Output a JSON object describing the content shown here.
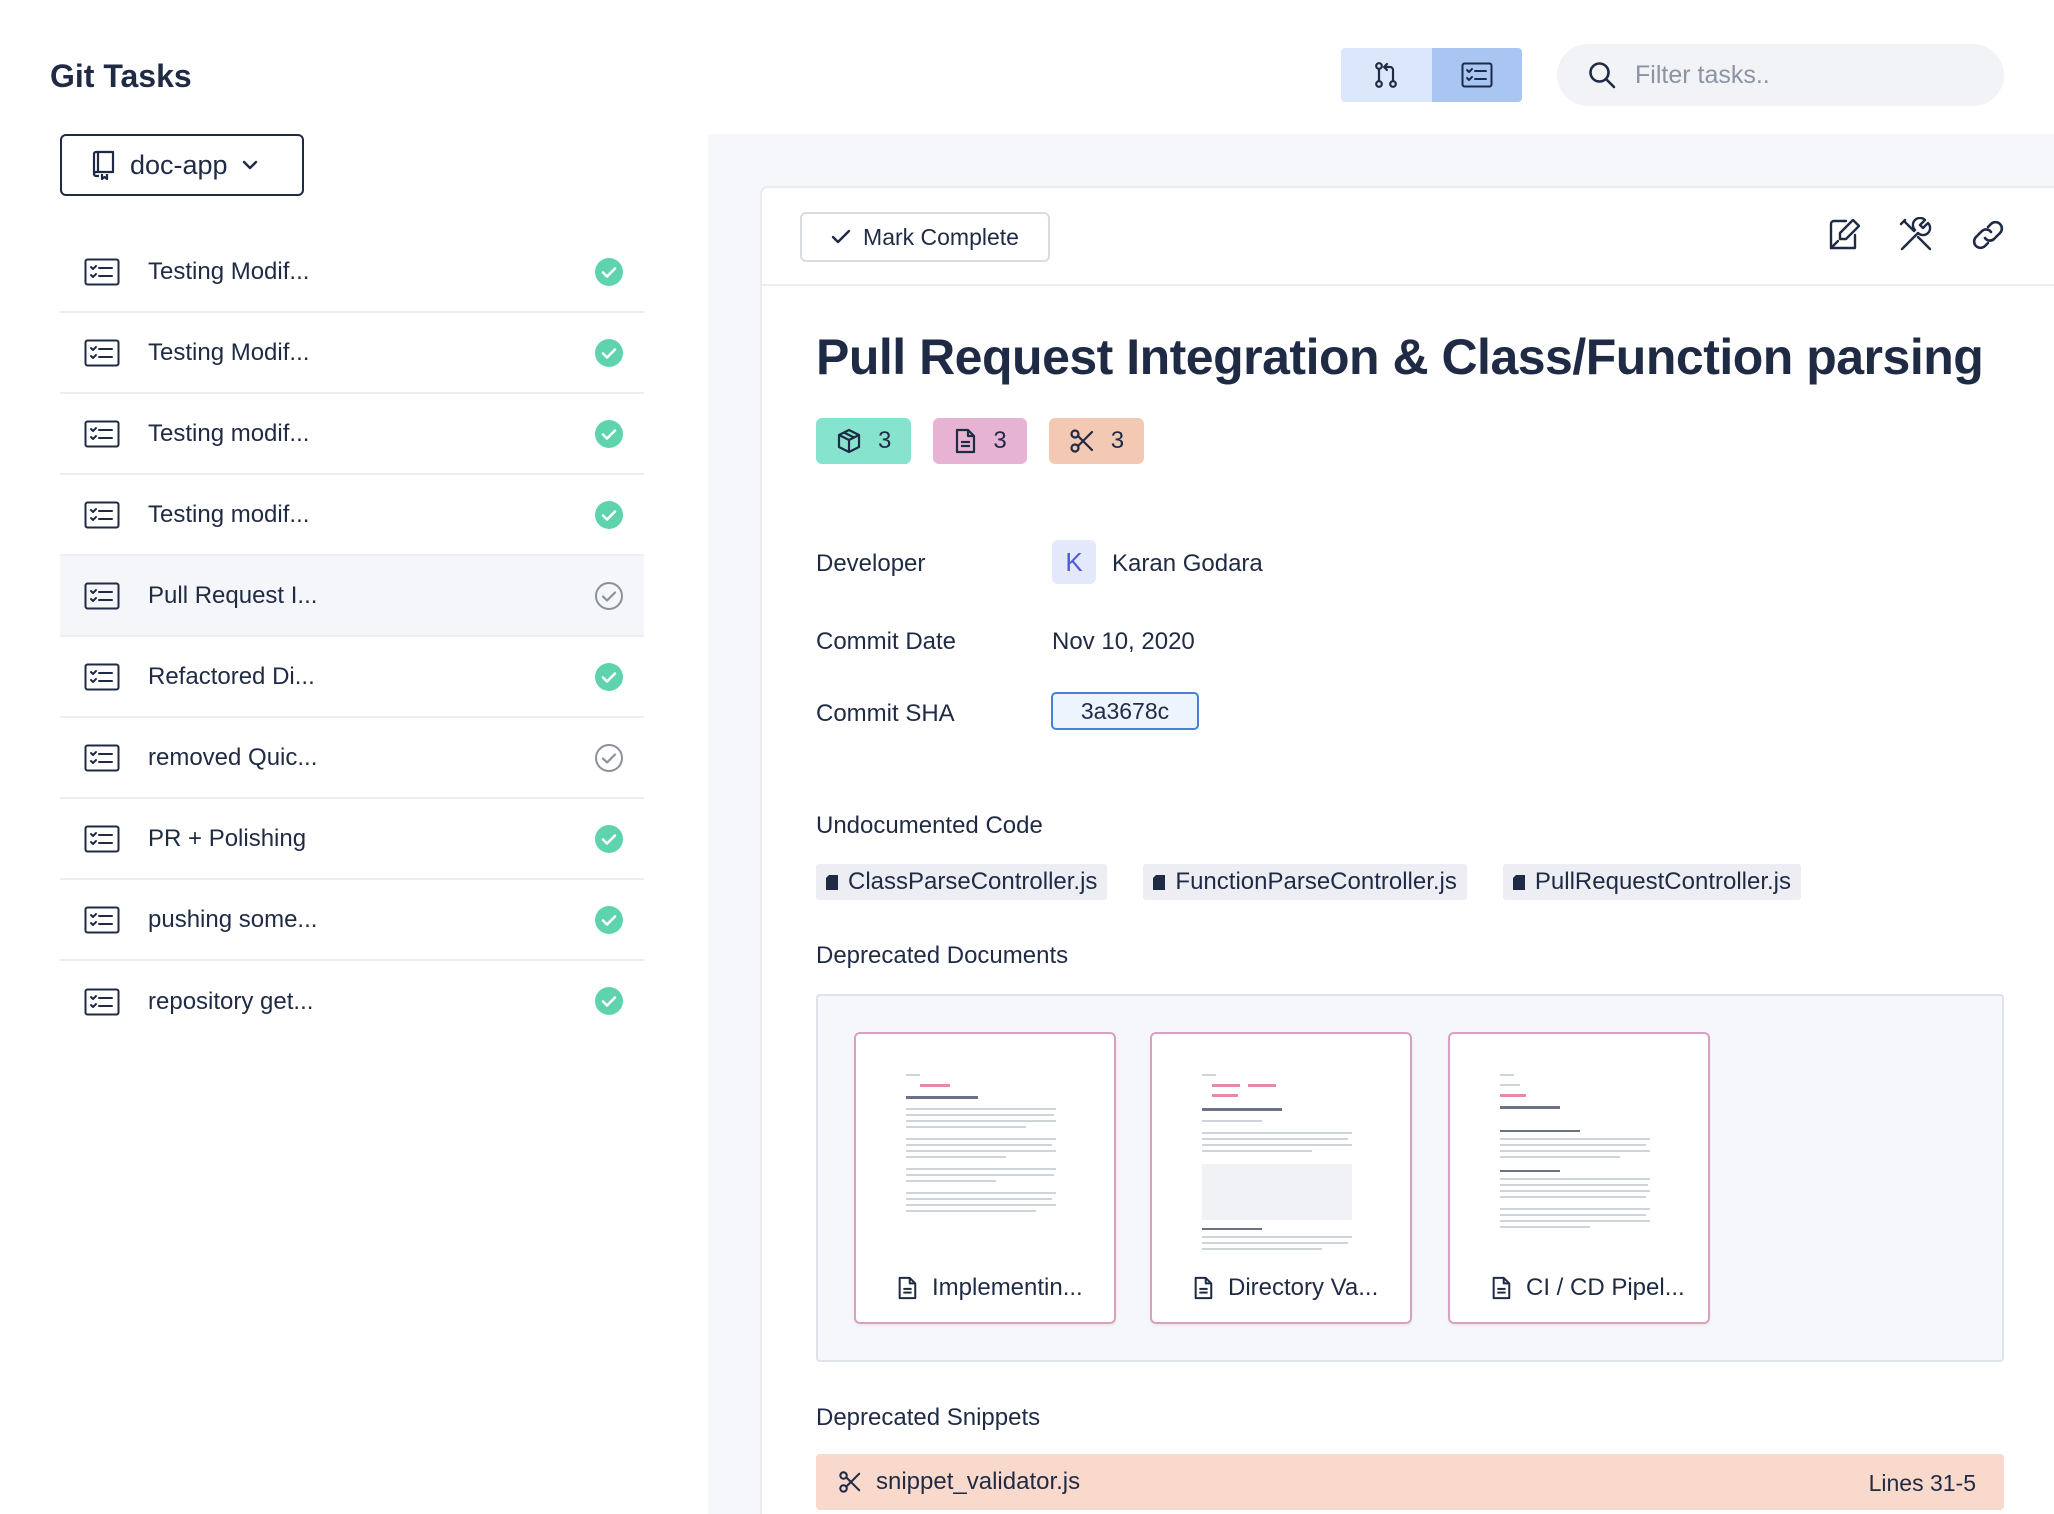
{
  "app": {
    "title": "Git Tasks"
  },
  "header": {
    "view_toggle": [
      {
        "icon": "pull-request-icon",
        "active": false
      },
      {
        "icon": "task-list-icon",
        "active": true
      }
    ],
    "search": {
      "placeholder": "Filter tasks..",
      "value": ""
    }
  },
  "sidebar": {
    "repo": {
      "name": "doc-app",
      "icon": "repository-icon"
    },
    "tasks": [
      {
        "label": "Testing Modif...",
        "status": "complete"
      },
      {
        "label": "Testing Modif...",
        "status": "complete"
      },
      {
        "label": "Testing modif...",
        "status": "complete"
      },
      {
        "label": "Testing modif...",
        "status": "complete"
      },
      {
        "label": "Pull Request I...",
        "status": "pending",
        "selected": true
      },
      {
        "label": "Refactored Di...",
        "status": "complete"
      },
      {
        "label": "removed Quic...",
        "status": "pending"
      },
      {
        "label": "PR + Polishing",
        "status": "complete"
      },
      {
        "label": "pushing some...",
        "status": "complete"
      },
      {
        "label": "repository get...",
        "status": "complete"
      }
    ]
  },
  "detail": {
    "toolbar": {
      "mark_complete": "Mark Complete",
      "icons": [
        "edit-icon",
        "tools-icon",
        "link-icon"
      ]
    },
    "title": "Pull Request Integration & Class/Function parsing",
    "badges": {
      "code": "3",
      "documents": "3",
      "snippets": "3"
    },
    "developer": {
      "label": "Developer",
      "initial": "K",
      "name": "Karan Godara"
    },
    "commit_date": {
      "label": "Commit Date",
      "value": "Nov 10, 2020"
    },
    "commit_sha": {
      "label": "Commit SHA",
      "value": "3a3678c"
    },
    "undocumented_code": {
      "label": "Undocumented Code",
      "files": [
        "ClassParseController.js",
        "FunctionParseController.js",
        "PullRequestController.js"
      ]
    },
    "deprecated_documents": {
      "label": "Deprecated Documents",
      "docs": [
        "Implementin...",
        "Directory Va...",
        "CI / CD Pipel..."
      ]
    },
    "deprecated_snippets": {
      "label": "Deprecated Snippets",
      "items": [
        {
          "name": "snippet_validator.js",
          "lines": "Lines 31-5"
        }
      ]
    }
  },
  "colors": {
    "text": "#1f2a44",
    "complete_green": "#5fd3ad",
    "badge_code": "#86e3cd",
    "badge_doc": "#e7b3d3",
    "badge_snippet": "#f4c9b4",
    "sha_border": "#4a7fd6",
    "snippet_bg": "#f8d9cc"
  }
}
